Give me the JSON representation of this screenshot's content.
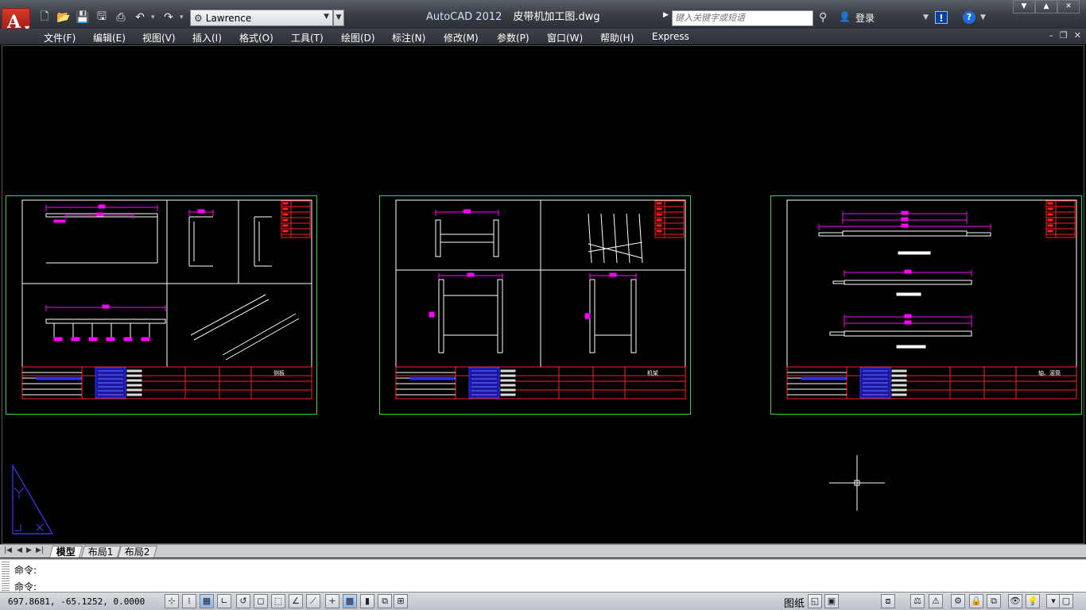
{
  "app": {
    "menu_icon": "autocad-logo-icon",
    "app_letter": "A",
    "product": "AutoCAD 2012",
    "filename": "皮带机加工图.dwg"
  },
  "qat": [
    {
      "name": "new-file-icon",
      "glyph": "🗋"
    },
    {
      "name": "open-file-icon",
      "glyph": "📂"
    },
    {
      "name": "save-icon",
      "glyph": "💾"
    },
    {
      "name": "save-as-icon",
      "glyph": "🖫"
    },
    {
      "name": "print-icon",
      "glyph": "⎙"
    },
    {
      "name": "undo-icon",
      "glyph": "↶"
    },
    {
      "name": "redo-icon",
      "glyph": "↷"
    }
  ],
  "workspace": {
    "value": "Lawrence",
    "icon": "gear-icon"
  },
  "search": {
    "placeholder": "键入关键字或短语"
  },
  "account": {
    "label": "登录",
    "icon": "user-icon"
  },
  "menu": [
    "文件(F)",
    "编辑(E)",
    "视图(V)",
    "插入(I)",
    "格式(O)",
    "工具(T)",
    "绘图(D)",
    "标注(N)",
    "修改(M)",
    "参数(P)",
    "窗口(W)",
    "帮助(H)",
    "Express"
  ],
  "layout_tabs": [
    {
      "label": "模型",
      "active": true
    },
    {
      "label": "布局1",
      "active": false
    },
    {
      "label": "布局2",
      "active": false
    }
  ],
  "command": {
    "history": "命令:",
    "prompt": "命令:"
  },
  "status": {
    "coords": "697.8681, -65.1252, 0.0000",
    "paper": "图纸",
    "toggles": [
      "infer-constraints",
      "snap",
      "grid",
      "ortho",
      "polar",
      "osnap",
      "3dosnap",
      "otrack",
      "ducs",
      "dyn",
      "lineweight",
      "transparency",
      "quick-properties",
      "selection-cycling"
    ]
  },
  "sheets": [
    {
      "name": "sheet-side-plate",
      "project_label": "侧板"
    },
    {
      "name": "sheet-frame",
      "project_label": "机架"
    },
    {
      "name": "sheet-shaft-roller",
      "project_label": "轴、滚筒"
    }
  ],
  "colors": {
    "sheet_border": "#2fd52f",
    "dimension": "#ff00ff",
    "title_red": "#ff2020",
    "drawing": "#ffffff",
    "stamp_blue": "#3030ff"
  }
}
